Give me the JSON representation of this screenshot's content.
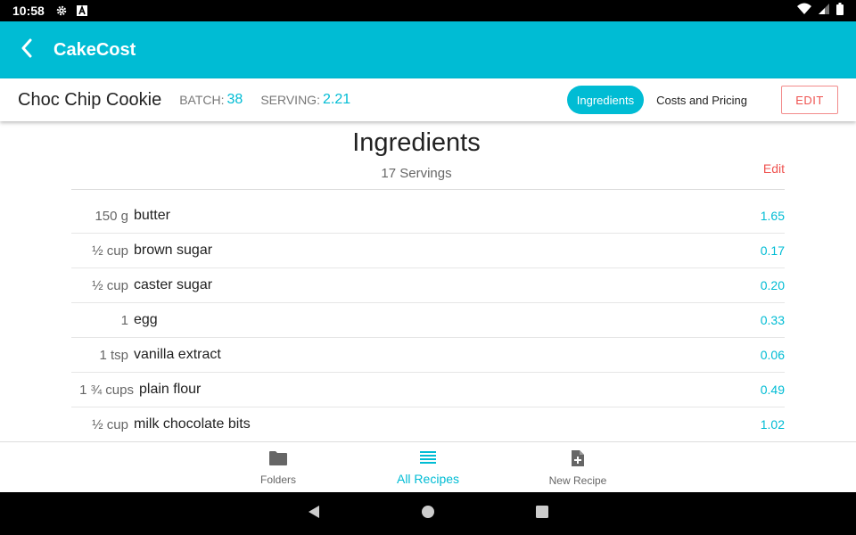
{
  "status_bar": {
    "time": "10:58",
    "icons": [
      "settings-gear-icon",
      "font-a-icon",
      "wifi-icon",
      "signal-icon",
      "battery-icon"
    ]
  },
  "app_bar": {
    "title": "CakeCost",
    "back_icon": "chevron-left-icon",
    "background_color": "#00bcd4"
  },
  "recipe": {
    "name": "Choc Chip Cookie",
    "batch_label": "BATCH:",
    "batch_value": "38",
    "serving_label": "SERVING:",
    "serving_value": "2.21",
    "tabs": [
      {
        "label": "Ingredients",
        "active": true
      },
      {
        "label": "Costs and Pricing",
        "active": false
      }
    ],
    "edit_button": "EDIT"
  },
  "ingredients_panel": {
    "title": "Ingredients",
    "servings": "17 Servings",
    "edit_link": "Edit",
    "items": [
      {
        "qty": "150 g",
        "name": "butter",
        "cost": "1.65"
      },
      {
        "qty": "½ cup",
        "name": "brown sugar",
        "cost": "0.17"
      },
      {
        "qty": "½ cup",
        "name": "caster sugar",
        "cost": "0.20"
      },
      {
        "qty": "1",
        "name": "egg",
        "cost": "0.33"
      },
      {
        "qty": "1 tsp",
        "name": "vanilla extract",
        "cost": "0.06"
      },
      {
        "qty": "1 ¾ cups",
        "name": "plain flour",
        "cost": "0.49"
      },
      {
        "qty": "½ cup",
        "name": "milk chocolate bits",
        "cost": "1.02"
      }
    ]
  },
  "bottom_nav": {
    "items": [
      {
        "label": "Folders",
        "icon": "folder-icon",
        "active": false
      },
      {
        "label": "All Recipes",
        "icon": "list-icon",
        "active": true
      },
      {
        "label": "New Recipe",
        "icon": "new-document-icon",
        "active": false
      }
    ]
  },
  "colors": {
    "accent": "#00bcd4",
    "danger": "#ef5350"
  }
}
